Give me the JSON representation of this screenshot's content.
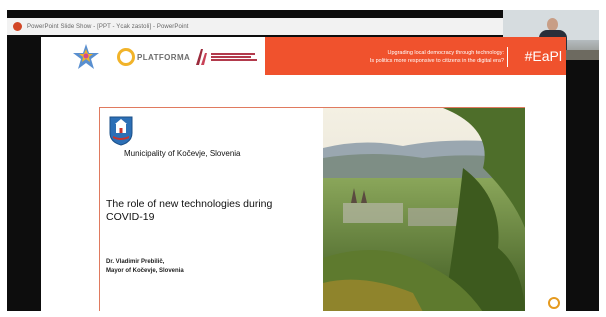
{
  "window": {
    "title": "PowerPoint Slide Show - [PPT - Ycak zastoli] - PowerPoint"
  },
  "slide": {
    "banner": {
      "line1": "Upgrading local democracy through technology:",
      "line2": "Is politics more responsive to citizens in the digital era?",
      "hashtag": "#EaPl"
    },
    "logos": {
      "platforma": "PLATFORMA"
    },
    "municipality": "Municipality of Kočevje, Slovenia",
    "title_line1": "The role of new technologies during",
    "title_line2": "COVID-19",
    "presenter_name": "Dr. Vladimir Prebilič,",
    "presenter_role": "Mayor of Kočevje, Slovenia"
  },
  "colors": {
    "banner": "#f0522d",
    "frame": "#e07a5f",
    "accent_gold": "#f1b329"
  }
}
